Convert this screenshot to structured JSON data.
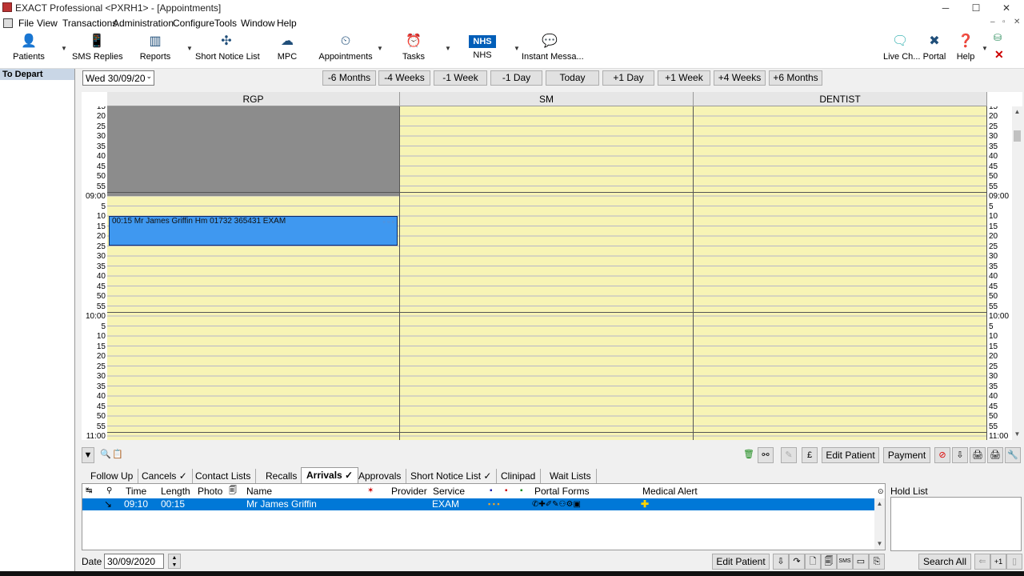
{
  "window": {
    "title": "EXACT Professional <PXRH1> - [Appointments]",
    "minimize": "─",
    "maximize": "☐",
    "close": "✕"
  },
  "menu": [
    "File",
    "View",
    "Transactions",
    "Administration",
    "Configure",
    "Tools",
    "Window",
    "Help"
  ],
  "menu_right_controls": [
    "–",
    "▫",
    "✕"
  ],
  "toolbar": {
    "patients": "Patients",
    "sms_replies": "SMS Replies",
    "reports": "Reports",
    "short_notice": "Short Notice List",
    "mpc": "MPC",
    "appointments": "Appointments",
    "tasks": "Tasks",
    "nhs": "NHS",
    "nhs_logo": "NHS",
    "instant_msg": "Instant Messa...",
    "live_chat": "Live Ch...",
    "portal": "Portal",
    "help": "Help"
  },
  "sidebar": {
    "heading": "To Depart"
  },
  "nav": {
    "date": "Wed 30/09/20",
    "buttons": [
      "-6 Months",
      "-4 Weeks",
      "-1 Week",
      "-1 Day",
      "Today",
      "+1 Day",
      "+1 Week",
      "+4 Weeks",
      "+6 Months"
    ]
  },
  "schedule": {
    "providers": [
      "RGP",
      "SM",
      "DENTIST"
    ],
    "time_labels": [
      "15",
      "20",
      "25",
      "30",
      "35",
      "40",
      "45",
      "50",
      "55",
      "09:00",
      "5",
      "10",
      "15",
      "20",
      "25",
      "30",
      "35",
      "40",
      "45",
      "50",
      "55",
      "10:00",
      "5",
      "10",
      "15",
      "20",
      "25",
      "30",
      "35",
      "40",
      "45",
      "50",
      "55",
      "11:00"
    ],
    "appointment": {
      "text": "00:15   Mr James Griffin   Hm 01732 365431   EXAM",
      "provider": "RGP",
      "start": "09:10",
      "length": "00:15",
      "marks": "▫ ▫ ▫"
    }
  },
  "lower_toolbar": {
    "edit_patient": "Edit Patient",
    "payment": "Payment",
    "icons": [
      "▼",
      "🔍",
      "📋",
      "🗑",
      "⚯",
      "✎",
      "£",
      "⊘",
      "⇩",
      "🖨",
      "🖨",
      "🔧"
    ]
  },
  "tabs": [
    "Follow Up",
    "Cancels ✓",
    "Contact Lists",
    "Recalls",
    "Arrivals ✓",
    "Approvals",
    "Short Notice List ✓",
    "Clinipad",
    "Wait Lists"
  ],
  "arrivals": {
    "columns": {
      "icon1": "↹",
      "icon2": "⚲",
      "time": "Time",
      "length": "Length",
      "photo": "Photo",
      "icon3": "🗐",
      "name": "Name",
      "icon4": "✶",
      "provider": "Provider",
      "service": "Service",
      "icon5": "▪",
      "icon6": "▪",
      "icon7": "▪",
      "portal": "Portal Forms",
      "alert": "Medical Alert"
    },
    "row": {
      "status_icon": "↘",
      "time": "09:10",
      "length": "00:15",
      "name": "Mr James Griffin",
      "service": "EXAM",
      "dots": "▪  ▪  ▪",
      "portal_icons": "✆✚✐✎⚇⚙▣",
      "alert_icon": "✚"
    }
  },
  "hold_list": {
    "label": "Hold List"
  },
  "bottom": {
    "date_label": "Date",
    "date_value": "30/09/2020",
    "edit_patient": "Edit Patient",
    "search_all": "Search All",
    "icons": [
      "⇩",
      "↷",
      "🗋",
      "🗐",
      "SMS",
      "▭",
      "⎘"
    ],
    "right_icons": [
      "⇐",
      "+1",
      "▯"
    ]
  },
  "colors": {
    "selection": "#0078d7",
    "appointment": "#3f98f0",
    "schedule_bg": "#f7f4b5",
    "blocked": "#8c8c8c"
  }
}
